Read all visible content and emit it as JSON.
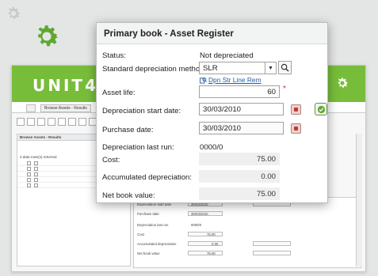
{
  "colors": {
    "brand_green": "#77bd3a",
    "gear_green": "#5fa830",
    "gear_grey": "#c8cbca",
    "link_blue": "#1b5fae"
  },
  "background_app": {
    "logo": "UNIT4",
    "tab_label": "Browse Assets - Results",
    "panel_title": "Browse Assets - Results",
    "records_returned": "4 data rows(s) returned",
    "right_labels": [
      "Depreciation start date",
      "Purchase date",
      "Depreciation last run",
      "Cost",
      "Accumulated depreciation",
      "Net book value"
    ],
    "right_values": [
      "30/03/2010",
      "30/03/2010",
      "0000/0",
      "75.00",
      "0.00",
      "75.00"
    ]
  },
  "dialog": {
    "title": "Primary book - Asset Register",
    "status_label": "Status:",
    "status_value": "Not depreciated",
    "method_label": "Standard depreciation method:",
    "method_value": "SLR",
    "method_link": "Dpn Str Line Rem",
    "life_label": "Asset life:",
    "life_value": "60",
    "required_mark": "*",
    "start_label": "Depreciation start date:",
    "start_value": "30/03/2010",
    "purchase_label": "Purchase date:",
    "purchase_value": "30/03/2010",
    "last_run_label": "Depreciation last run:",
    "last_run_value": "0000/0",
    "cost_label": "Cost:",
    "cost_value": "75.00",
    "accum_label": "Accumulated depreciation:",
    "accum_value": "0.00",
    "nbv_label": "Net book value:",
    "nbv_value": "75.00"
  }
}
